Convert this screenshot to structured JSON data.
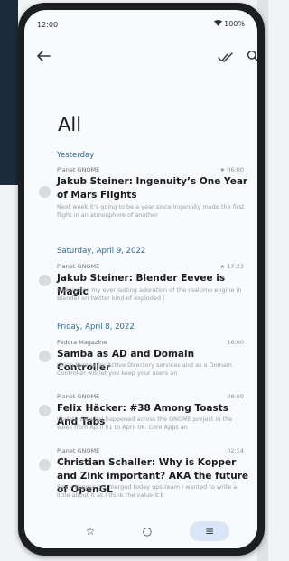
{
  "status": {
    "time": "12:00",
    "battery": "100%"
  },
  "page": {
    "title": "All"
  },
  "sections": [
    {
      "date": "Yesterday",
      "items": [
        {
          "source": "Planet GNOME",
          "meta": "★ 06:00",
          "title": "Jakub Steiner: Ingenuity’s One Year of Mars Flights",
          "snippet": "Next week it’s going to be a year since Ingenuity made the first flight in an atmosphere of another"
        }
      ]
    },
    {
      "date": "Saturday, April 9, 2022",
      "items": [
        {
          "source": "Planet GNOME",
          "meta": "★ 17:23",
          "title": "Jakub Steiner: Blender Eevee is Magic",
          "snippet": "Mentioning my ever lasting adoration of the realtime engine in Blender on twitter kind of exploded ("
        }
      ]
    },
    {
      "date": "Friday, April 8, 2022",
      "items": [
        {
          "source": "Fedora Magazine",
          "meta": "16:00",
          "title": "Samba as AD and Domain Controller",
          "snippet": "Using Samba for Active Directory services and as a Domain Controller will let you keep your users an"
        },
        {
          "source": "Planet GNOME",
          "meta": "08:00",
          "title": "Felix Häcker: #38 Among Toasts And Tabs",
          "snippet": "Update on what happened across the GNOME project in the week from April 01 to April 08. Core Apps an"
        },
        {
          "source": "Planet GNOME",
          "meta": "02:14",
          "title": "Christian Schaller: Why is Kopper and Zink important? AKA the future of OpenGL",
          "snippet": "Since Kopper got merged today upstream I wanted to write a little about it as I think the value it b"
        }
      ]
    }
  ],
  "icons": {
    "back": "arrow-back-icon",
    "mark_read": "done-all-icon",
    "search": "search-icon",
    "starred": "star-outline-icon",
    "unread": "circle-outline-icon",
    "all": "list-icon"
  },
  "colors": {
    "section_header": "#2c6a8c",
    "nav_active": "#d8e6f8"
  }
}
